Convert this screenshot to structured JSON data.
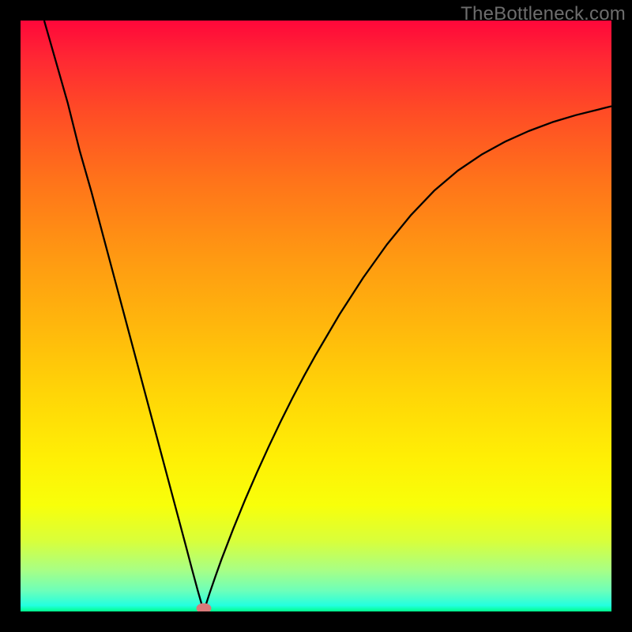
{
  "watermark": "TheBottleneck.com",
  "chart_data": {
    "type": "line",
    "title": "",
    "xlabel": "",
    "ylabel": "",
    "xlim": [
      0,
      100
    ],
    "ylim": [
      0,
      100
    ],
    "optimum_x": 31,
    "marker_color": "#d87a7a",
    "gradient_stops": [
      {
        "pos": 0,
        "color": "#ff073a"
      },
      {
        "pos": 0.27,
        "color": "#ff731a"
      },
      {
        "pos": 0.52,
        "color": "#ffb80c"
      },
      {
        "pos": 0.74,
        "color": "#ffef05"
      },
      {
        "pos": 0.93,
        "color": "#a8ff85"
      },
      {
        "pos": 1.0,
        "color": "#00ff8a"
      }
    ],
    "series": [
      {
        "name": "bottleneck",
        "x": [
          4,
          6,
          8,
          10,
          12,
          14,
          16,
          18,
          20,
          22,
          24,
          26,
          28,
          29,
          30,
          31,
          32,
          33,
          34,
          36,
          38,
          40,
          42,
          44,
          46,
          48,
          50,
          54,
          58,
          62,
          66,
          70,
          74,
          78,
          82,
          86,
          90,
          94,
          98,
          100
        ],
        "y": [
          100,
          93,
          86,
          78,
          71,
          63.5,
          56,
          48.5,
          41,
          33.5,
          26,
          18.5,
          11,
          7.2,
          3.5,
          0,
          3.1,
          6.0,
          8.8,
          14.0,
          18.9,
          23.5,
          27.9,
          32.1,
          36.1,
          39.9,
          43.5,
          50.3,
          56.5,
          62.1,
          67.0,
          71.2,
          74.6,
          77.3,
          79.5,
          81.3,
          82.8,
          84.0,
          85.0,
          85.5
        ]
      }
    ]
  }
}
